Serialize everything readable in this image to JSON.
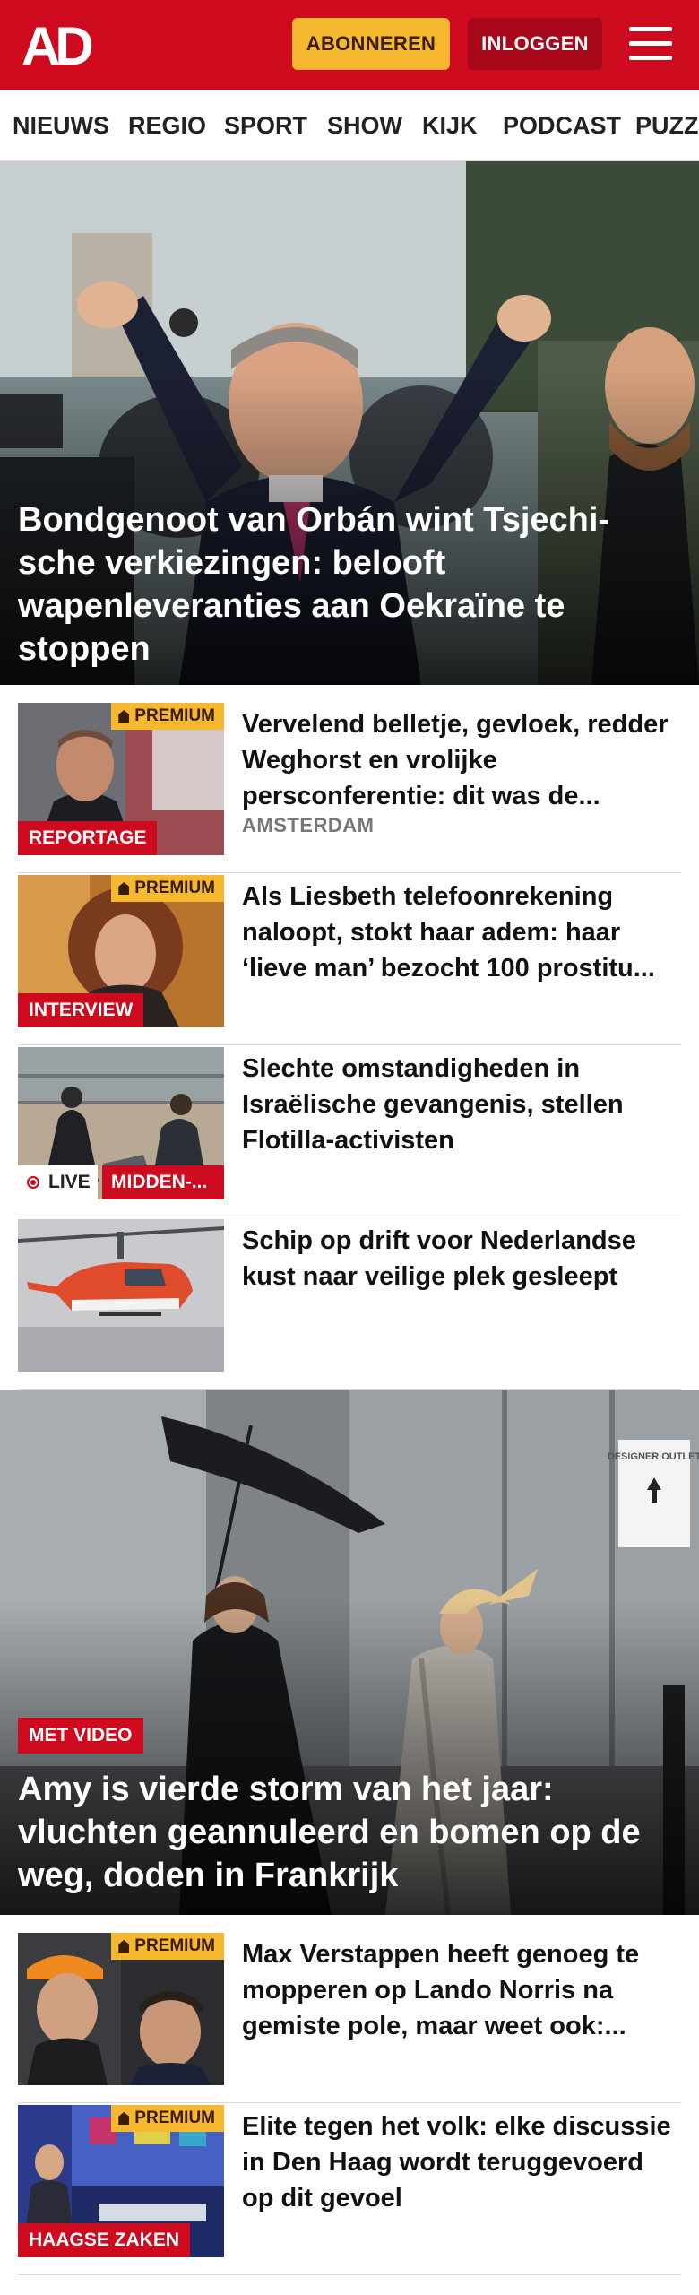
{
  "header": {
    "logo_text": "AD",
    "subscribe_label": "ABONNEREN",
    "login_label": "INLOGGEN",
    "brand_color": "#cd0a1e",
    "accent_color": "#f5b82e"
  },
  "nav": {
    "items": [
      "NIEUWS",
      "REGIO",
      "SPORT",
      "SHOW",
      "KIJK",
      "PODCAST",
      "PUZZ"
    ]
  },
  "hero1": {
    "title": "Bondgenoot van Orbán wint Tsjechi-sche verkiezingen: belooft wapenleveranties aan Oekraïne te stoppen"
  },
  "articles": [
    {
      "premium": "PREMIUM",
      "label": "REPORTAGE",
      "headline": "Vervelend belletje, gevloek, redder Weghorst en vrolijke persconferentie: dit was de...",
      "location": "AMSTERDAM"
    },
    {
      "premium": "PREMIUM",
      "label": "INTERVIEW",
      "headline": "Als Liesbeth telefoonrekening naloopt, stokt haar adem: haar ‘lieve man’ bezocht 100 prostitu..."
    },
    {
      "live": "LIVE",
      "category": "MIDDEN-...",
      "headline": "Slechte omstandigheden in Israëlische gevangenis, stellen Flotilla-activisten"
    },
    {
      "headline": "Schip op drift voor Nederlandse kust naar veilige plek gesleept"
    }
  ],
  "hero2": {
    "tag": "MET VIDEO",
    "title": "Amy is vierde storm van het jaar: vluchten geannuleerd en bomen op de weg, doden in Frankrijk",
    "sign_text": "DESIGNER OUTLET"
  },
  "articles2": [
    {
      "premium": "PREMIUM",
      "headline": "Max Verstappen heeft genoeg te mopperen op Lando Norris na gemiste pole, maar weet ook:..."
    },
    {
      "premium": "PREMIUM",
      "label": "HAAGSE ZAKEN",
      "headline": "Elite tegen het volk: elke discussie in Den Haag wordt teruggevoerd op dit gevoel"
    }
  ]
}
